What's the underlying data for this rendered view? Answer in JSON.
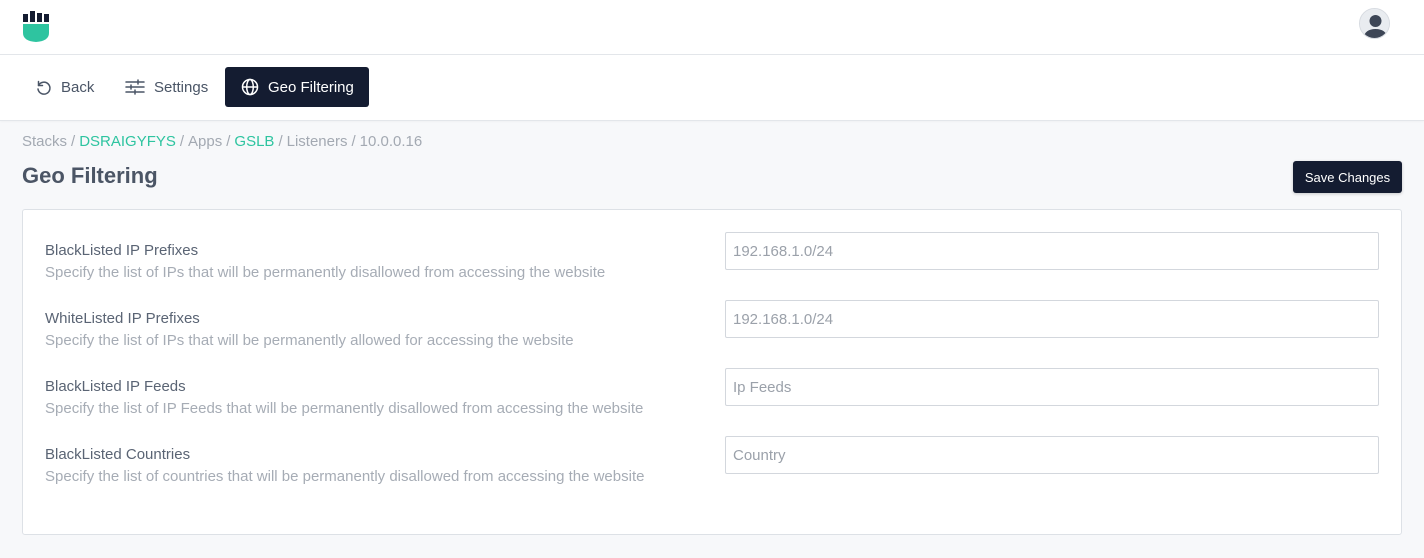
{
  "tabs": {
    "back": "Back",
    "settings": "Settings",
    "geo": "Geo Filtering"
  },
  "breadcrumb": {
    "stacks": "Stacks",
    "stack_id": "DSRAIGYFYS",
    "apps": "Apps",
    "app": "GSLB",
    "listeners": "Listeners",
    "ip": "10.0.0.16"
  },
  "page": {
    "title": "Geo Filtering",
    "save_label": "Save Changes"
  },
  "fields": [
    {
      "label": "BlackListed IP Prefixes",
      "description": "Specify the list of IPs that will be permanently disallowed from accessing the website",
      "placeholder": "192.168.1.0/24"
    },
    {
      "label": "WhiteListed IP Prefixes",
      "description": "Specify the list of IPs that will be permanently allowed for accessing the website",
      "placeholder": "192.168.1.0/24"
    },
    {
      "label": "BlackListed IP Feeds",
      "description": "Specify the list of IP Feeds that will be permanently disallowed from accessing the website",
      "placeholder": "Ip Feeds"
    },
    {
      "label": "BlackListed Countries",
      "description": "Specify the list of countries that will be permanently disallowed from accessing the website",
      "placeholder": "Country"
    }
  ],
  "icons": {
    "logo": "brand-logo-icon",
    "avatar": "user-avatar-icon",
    "back": "undo-icon",
    "settings": "sliders-icon",
    "geo": "globe-icon"
  },
  "colors": {
    "primary_dark": "#141c31",
    "accent_teal": "#2ec4a0"
  }
}
